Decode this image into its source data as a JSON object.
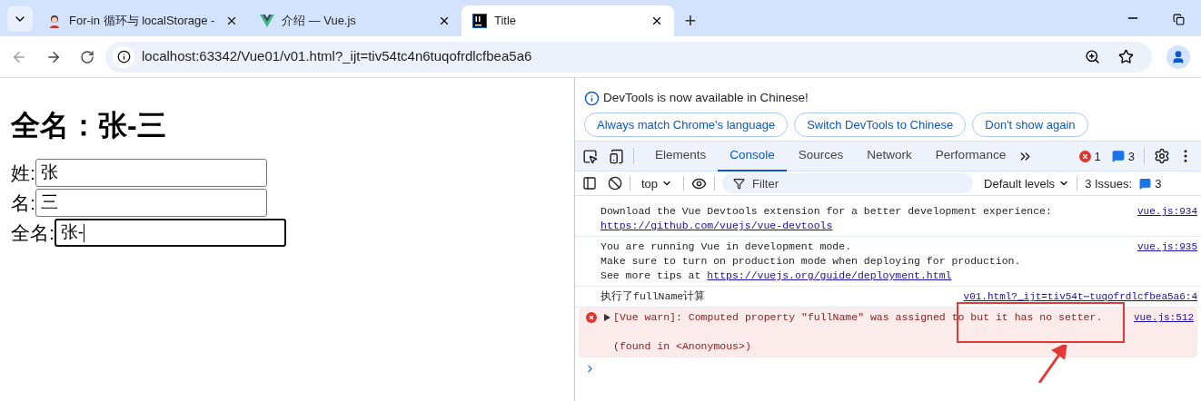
{
  "browser": {
    "tabs": [
      {
        "kind": "avatar",
        "title": "For-in 循环与 localStorage -",
        "selected": false
      },
      {
        "kind": "vue",
        "title": "介绍 — Vue.js",
        "selected": false
      },
      {
        "kind": "ij",
        "title": "Title",
        "selected": true
      }
    ],
    "new_tab": "+",
    "url": "localhost:63342/Vue01/v01.html?_ijt=tiv54tc4n6tuqofrdlcfbea5a6"
  },
  "page": {
    "heading": "全名：张-三",
    "fields": [
      {
        "label": "姓:",
        "value": "张",
        "focused": false
      },
      {
        "label": "名:",
        "value": "三",
        "focused": false
      },
      {
        "label": "全名:",
        "value": "张-",
        "focused": true
      }
    ]
  },
  "devtools": {
    "banner": {
      "message": "DevTools is now available in Chinese!",
      "buttons": [
        "Always match Chrome's language",
        "Switch DevTools to Chinese",
        "Don't show again"
      ]
    },
    "panel_tabs": [
      {
        "label": "Elements",
        "selected": false
      },
      {
        "label": "Console",
        "selected": true
      },
      {
        "label": "Sources",
        "selected": false
      },
      {
        "label": "Network",
        "selected": false
      },
      {
        "label": "Performance",
        "selected": false
      }
    ],
    "error_count": "1",
    "message_count": "3",
    "console_toolbar": {
      "context": "top",
      "filter_placeholder": "Filter",
      "levels": "Default levels",
      "issues_label": "3 Issues:",
      "issues_count": "3"
    },
    "messages": [
      {
        "kind": "info",
        "source": "vue.js:934",
        "lines": [
          {
            "text": "Download the Vue Devtools extension for a better development experience:"
          },
          {
            "link": "https://github.com/vuejs/vue-devtools"
          }
        ]
      },
      {
        "kind": "info",
        "source": "vue.js:935",
        "lines": [
          {
            "text": "You are running Vue in development mode."
          },
          {
            "text": "Make sure to turn on production mode when deploying for production."
          },
          {
            "text": "See more tips at ",
            "link": "https://vuejs.org/guide/deployment.html"
          }
        ]
      },
      {
        "kind": "log",
        "source": "v01.html?_ijt=tiv54t⋯tuqofrdlcfbea5a6:4",
        "lines": [
          {
            "text": "执行了fullName计算"
          }
        ]
      },
      {
        "kind": "error",
        "source": "vue.js:512",
        "lines": [
          {
            "text": "[Vue warn]: Computed property \"fullName\" was assigned to but it has no setter."
          },
          {
            "text": "(found in <Anonymous>)"
          }
        ]
      }
    ]
  }
}
